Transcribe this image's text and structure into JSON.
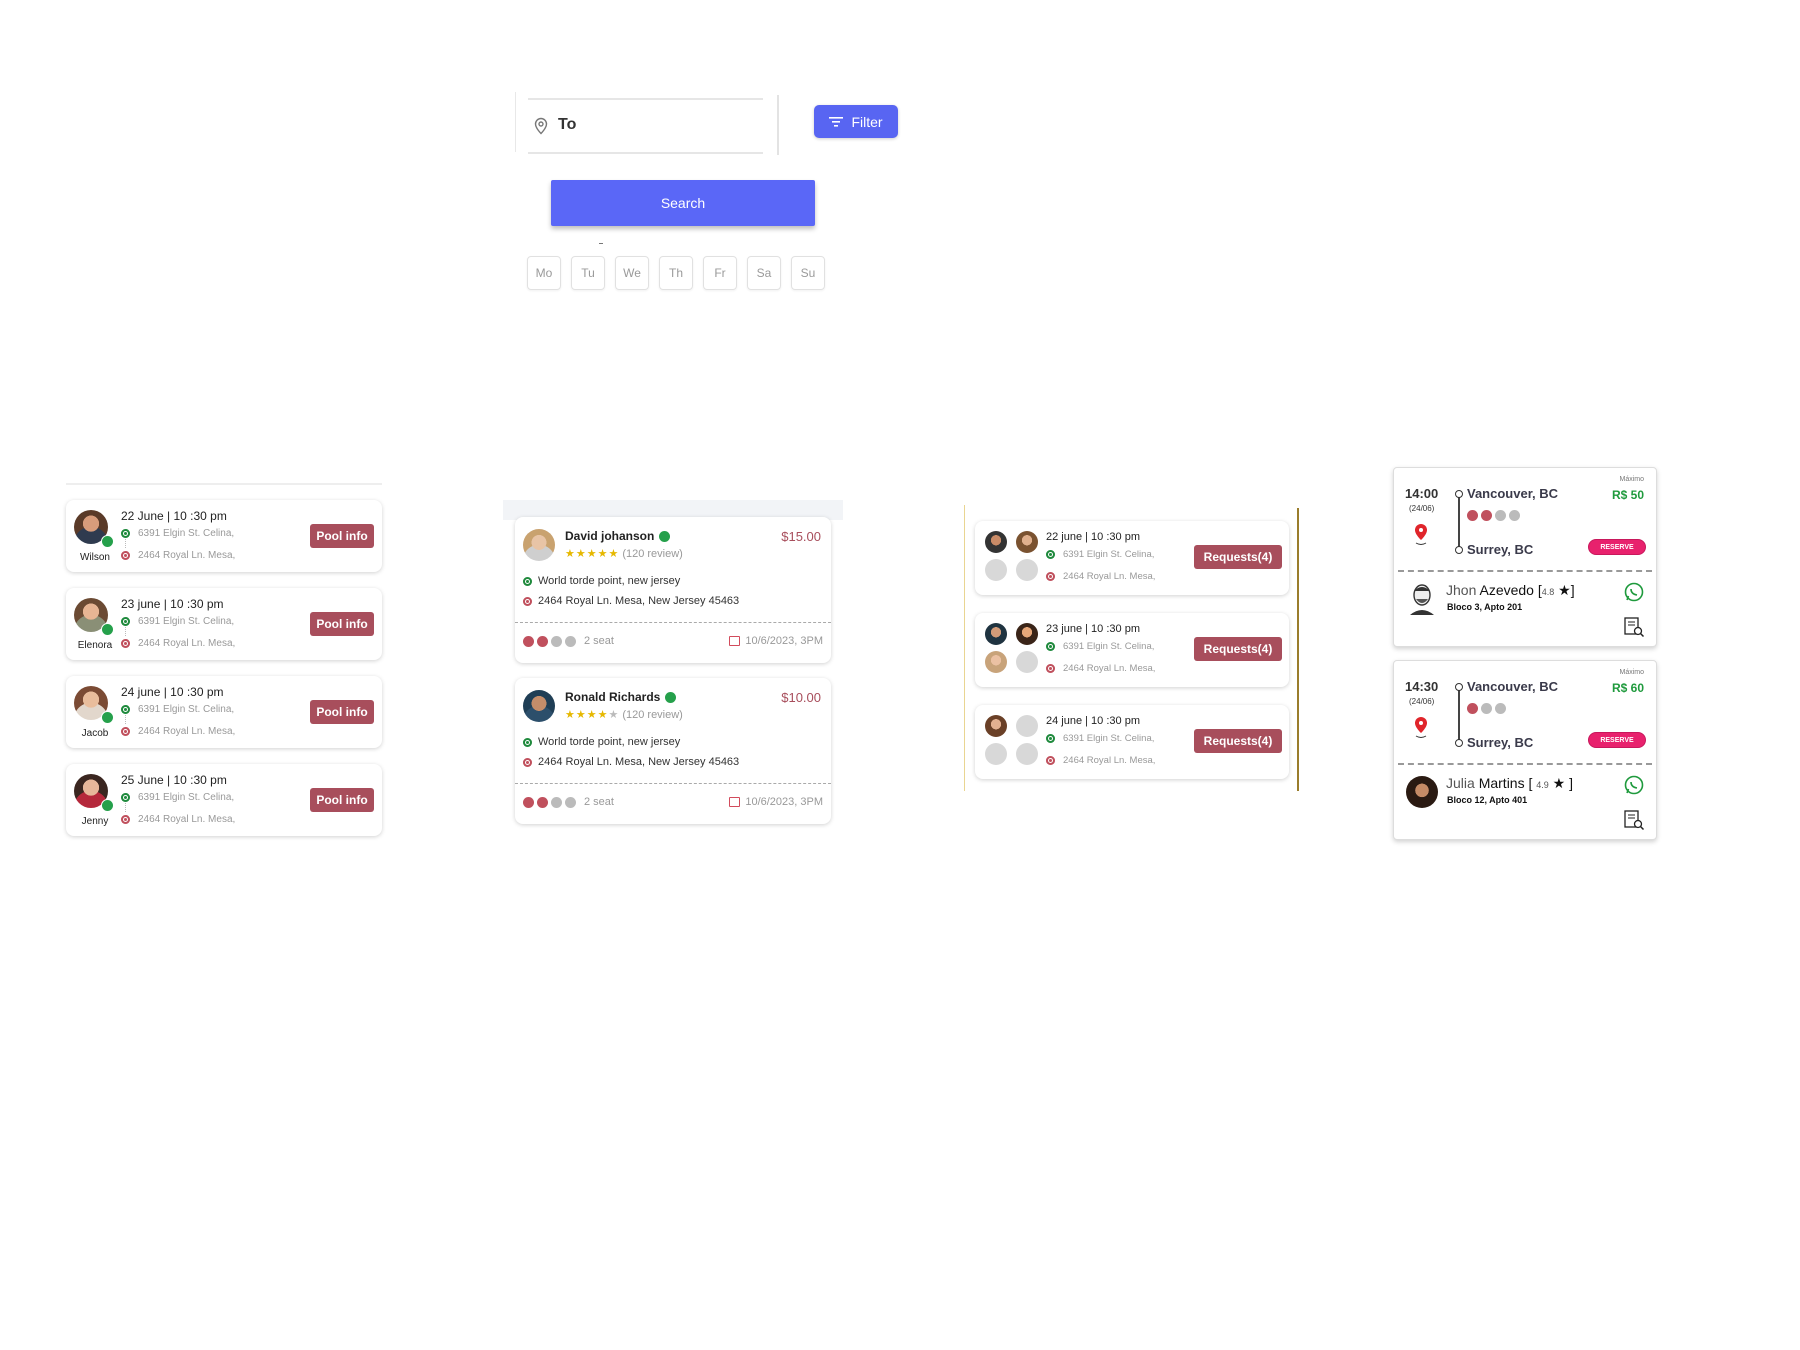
{
  "search": {
    "to_label": "To",
    "filter_label": "Filter",
    "search_label": "Search",
    "days": [
      "Mo",
      "Tu",
      "We",
      "Th",
      "Fr",
      "Sa",
      "Su"
    ]
  },
  "pool_list": {
    "button_label": "Pool info",
    "items": [
      {
        "name": "Wilson",
        "date": "22 June  | 10 :30 pm",
        "from": "6391 Elgin St. Celina,",
        "to": "2464 Royal Ln. Mesa,"
      },
      {
        "name": "Elenora",
        "date": "23 june  | 10 :30 pm",
        "from": "6391 Elgin St. Celina,",
        "to": "2464 Royal Ln. Mesa,"
      },
      {
        "name": "Jacob",
        "date": "24 june  | 10 :30 pm",
        "from": "6391 Elgin St. Celina,",
        "to": "2464 Royal Ln. Mesa,"
      },
      {
        "name": "Jenny",
        "date": "25 June | 10 :30 pm",
        "from": "6391 Elgin St. Celina,",
        "to": "2464 Royal Ln. Mesa,"
      }
    ]
  },
  "ride_offers": [
    {
      "driver": "David johanson",
      "price": "$15.00",
      "rating": 5,
      "reviews": "(120 review)",
      "from": "World torde point, new jersey",
      "to": "2464 Royal Ln. Mesa, New Jersey 45463",
      "seats": "2 seat",
      "date": "10/6/2023, 3PM"
    },
    {
      "driver": "Ronald Richards",
      "price": "$10.00",
      "rating": 4,
      "reviews": "(120 review)",
      "from": "World torde point, new jersey",
      "to": "2464 Royal Ln. Mesa, New Jersey 45463",
      "seats": "2 seat",
      "date": "10/6/2023, 3PM"
    }
  ],
  "requests": {
    "button_label": "Requests(4)",
    "items": [
      {
        "date": "22 june | 10 :30 pm",
        "from": "6391 Elgin St. Celina,",
        "to": "2464 Royal Ln. Mesa,"
      },
      {
        "date": "23 june | 10 :30 pm",
        "from": "6391 Elgin St. Celina,",
        "to": "2464 Royal Ln. Mesa,"
      },
      {
        "date": "24 june | 10 :30 pm",
        "from": "6391 Elgin St. Celina,",
        "to": "2464 Royal Ln. Mesa,"
      }
    ]
  },
  "trips": [
    {
      "time": "14:00",
      "date": "(24/06)",
      "from": "Vancouver, BC",
      "to": "Surrey, BC",
      "max_label": "Máximo",
      "price": "R$ 50",
      "reserve": "RESERVE",
      "driver_first": "Jhon ",
      "driver_last": "Azevedo",
      "rating": "4.8",
      "address": "Bloco 3, Apto 201"
    },
    {
      "time": "14:30",
      "date": "(24/06)",
      "from": "Vancouver, BC",
      "to": "Surrey, BC",
      "max_label": "Máximo",
      "price": "R$ 60",
      "reserve": "RESERVE",
      "driver_first": "Julia ",
      "driver_last": "Martins",
      "rating": "4.9",
      "address": "Bloco 12, Apto 401"
    }
  ],
  "colors": {
    "accent": "#5865f2",
    "pill": "#a84e5c",
    "green": "#1f8a3d",
    "reserve": "#e8216d"
  }
}
